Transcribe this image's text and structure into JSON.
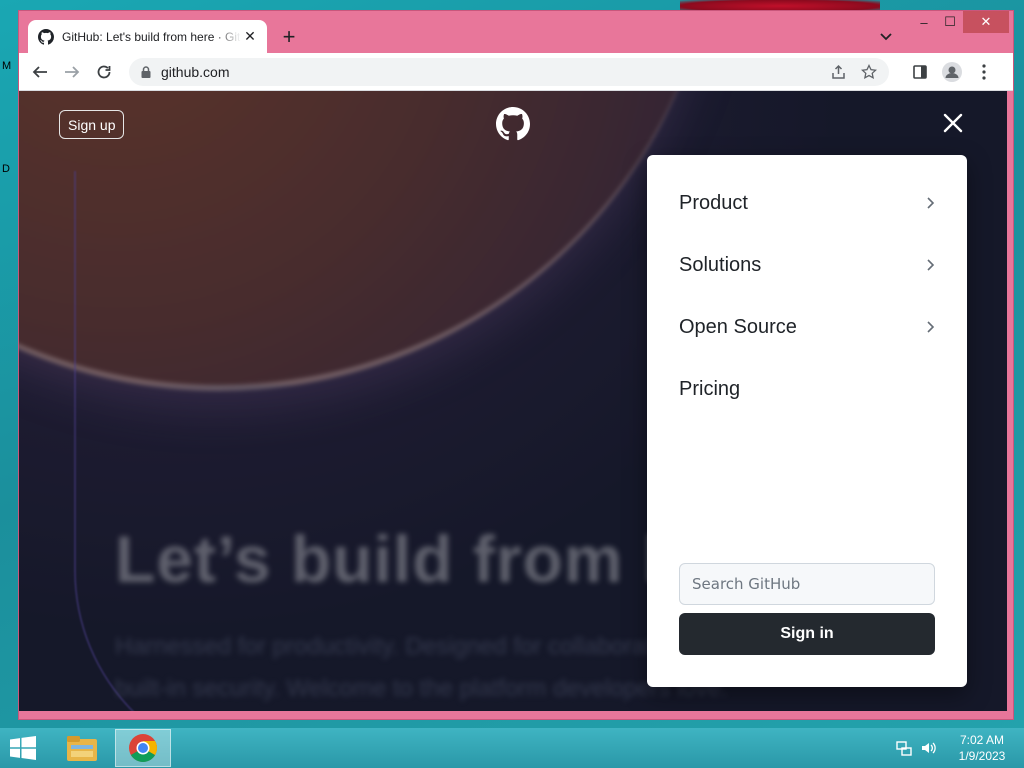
{
  "desktop": {
    "edge_chars": [
      "M",
      "D"
    ]
  },
  "browser": {
    "tab": {
      "title": "GitHub: Let's build from here · GitHub",
      "favicon": "github-icon"
    },
    "new_tab": "+",
    "url": "github.com",
    "window_controls": {
      "minimize": "–",
      "maximize": "☐",
      "close": "✕"
    }
  },
  "page": {
    "signup_label": "Sign up",
    "hero_title": "Let’s build from here",
    "hero_subtitle": "Harnessed for productivity. Designed for collaboration. Celebrated for built-in security. Welcome to the platform developers love.",
    "menu": {
      "items": [
        {
          "label": "Product",
          "has_submenu": true
        },
        {
          "label": "Solutions",
          "has_submenu": true
        },
        {
          "label": "Open Source",
          "has_submenu": true
        },
        {
          "label": "Pricing",
          "has_submenu": false
        }
      ],
      "search_placeholder": "Search GitHub",
      "signin_label": "Sign in"
    }
  },
  "taskbar": {
    "clock_time": "7:02 AM",
    "clock_date": "1/9/2023",
    "apps": [
      "file-explorer",
      "chrome"
    ]
  },
  "colors": {
    "window_frame": "#e8769a",
    "signin_bg": "#24292f",
    "desktop": "#1aa7b3"
  }
}
